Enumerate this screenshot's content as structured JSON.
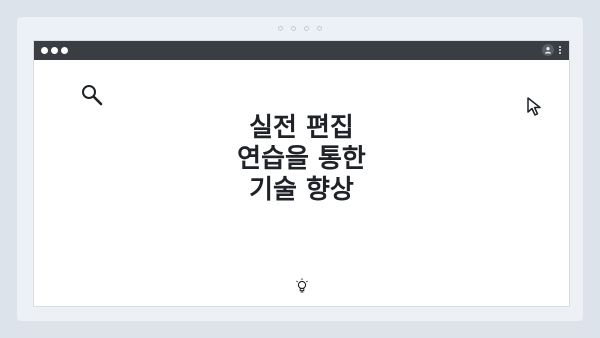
{
  "frame": {
    "pager_dots": 4
  },
  "window": {
    "titlebar": {
      "controls": [
        "dot",
        "dot",
        "dot"
      ],
      "right_icons": [
        "user-icon",
        "more-vertical-icon"
      ]
    },
    "icons": {
      "top_left": "search-icon",
      "top_right": "cursor-icon",
      "bottom_center": "lightbulb-icon"
    },
    "heading_lines": [
      "실전 편집",
      "연습을 통한",
      "기술 향상"
    ]
  },
  "colors": {
    "page_bg": "#dde3ea",
    "titlebar_bg": "#3a3d42",
    "text": "#1f2328"
  }
}
